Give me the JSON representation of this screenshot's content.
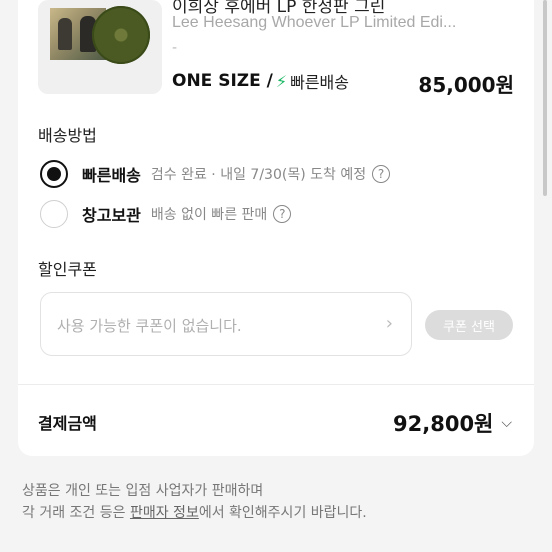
{
  "product": {
    "title": "이희상 후에버 LP 한정판 그린",
    "subtitle": "Lee Heesang Whoever LP Limited Edi...",
    "option_dash": "-",
    "size": "ONE SIZE /",
    "bolt_icon": "bolt-icon",
    "fast_label": "빠른배송",
    "price": "85,000원"
  },
  "shipping": {
    "section_title": "배송방법",
    "options": [
      {
        "title": "빠른배송",
        "desc": "검수 완료 · 내일 7/30(목) 도착 예정",
        "selected": true
      },
      {
        "title": "창고보관",
        "desc": "배송 없이 빠른 판매",
        "selected": false
      }
    ],
    "help_glyph": "?"
  },
  "coupon": {
    "section_title": "할인쿠폰",
    "placeholder": "사용 가능한 쿠폰이 없습니다.",
    "chevron": "›",
    "button_label": "쿠폰 선택"
  },
  "payment": {
    "label": "결제금액",
    "amount": "92,800원",
    "chevron": "⌵"
  },
  "notice": {
    "line1": "상품은 개인 또는 입점 사업자가 판매하며",
    "line2_prefix": "각 거래 조건 등은 ",
    "line2_link": "판매자 정보",
    "line2_suffix": "에서 확인해주시기 바랍니다."
  },
  "colors": {
    "accent_green": "#1bb763",
    "disabled_button": "#dcdcdc"
  }
}
